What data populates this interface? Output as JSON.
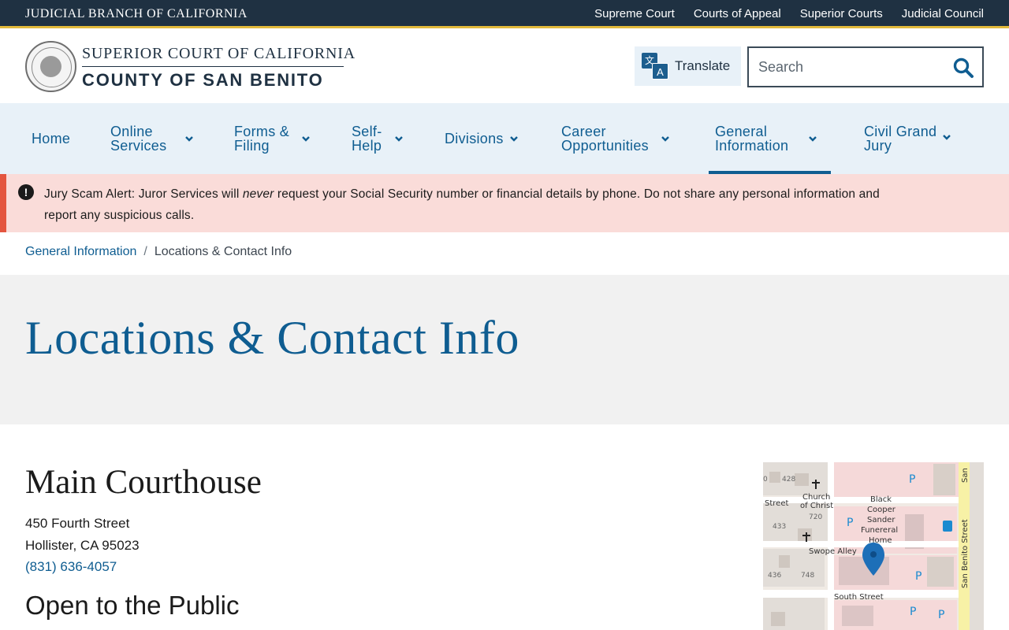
{
  "topbar": {
    "brand": "JUDICIAL BRANCH OF CALIFORNIA",
    "links": [
      "Supreme Court",
      "Courts of Appeal",
      "Superior Courts",
      "Judicial Council"
    ]
  },
  "header": {
    "org_line1": "SUPERIOR COURT OF CALIFORNIA",
    "org_line2": "COUNTY OF SAN BENITO",
    "translate_label": "Translate",
    "search_placeholder": "Search"
  },
  "nav": {
    "items": [
      {
        "line1": "Home",
        "line2": ""
      },
      {
        "line1": "Online",
        "line2": "Services"
      },
      {
        "line1": "Forms &",
        "line2": "Filing"
      },
      {
        "line1": "Self-",
        "line2": "Help"
      },
      {
        "line1": "Divisions",
        "line2": ""
      },
      {
        "line1": "Career",
        "line2": "Opportunities"
      },
      {
        "line1": "General",
        "line2": "Information"
      },
      {
        "line1": "Civil Grand",
        "line2": "Jury"
      }
    ]
  },
  "alert": {
    "prefix": "Jury Scam Alert: Juror Services will ",
    "emphasis": "never",
    "suffix": " request your Social Security number or financial details by phone. Do not share any personal information and report any suspicious calls."
  },
  "breadcrumb": {
    "parent": "General Information",
    "separator": "/",
    "current": "Locations & Contact Info"
  },
  "page": {
    "title": "Locations & Contact Info"
  },
  "location": {
    "name": "Main Courthouse",
    "street": "450 Fourth Street",
    "city": "Hollister, CA 95023",
    "phone": "(831) 636-4057",
    "section_heading": "Open to the Public"
  },
  "map": {
    "labels": {
      "street_left": "Street",
      "church": "Church",
      "church2": "of Christ",
      "funeral1": "Black",
      "funeral2": "Cooper",
      "funeral3": "Sander",
      "funeral4": "Funereral",
      "funeral5": "Home",
      "swope": "Swope Alley",
      "south": "South Street",
      "san_benito": "San Benito Street",
      "san_top": "San",
      "n428": "428",
      "n433": "433",
      "n720": "720",
      "n436": "436",
      "n748": "748",
      "n0": "0",
      "parking": "P"
    }
  }
}
